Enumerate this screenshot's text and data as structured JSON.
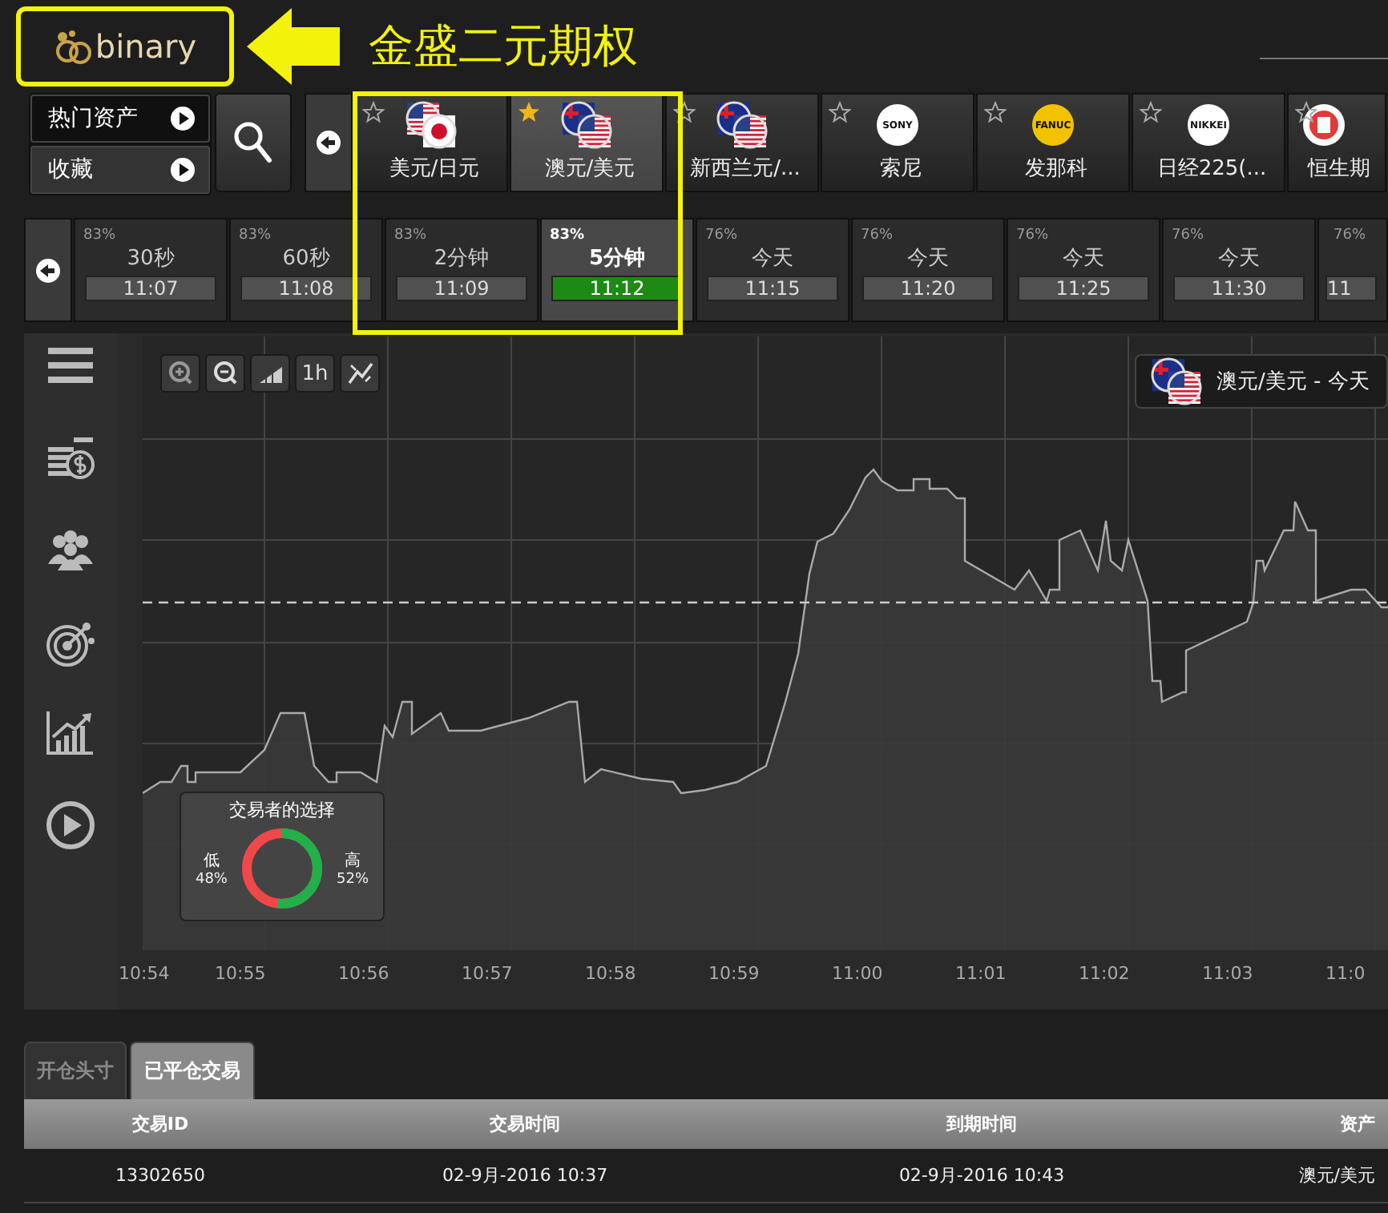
{
  "annotation": {
    "title": "金盛二元期权"
  },
  "logo": {
    "text": "binary"
  },
  "asset_menu": [
    {
      "label": "热门资产",
      "selected": true
    },
    {
      "label": "收藏",
      "selected": false
    }
  ],
  "assets": [
    {
      "label": "美元/日元",
      "starred": false,
      "selected": false,
      "kind": "pair",
      "flags": [
        {
          "kind": "us"
        },
        {
          "kind": "jp"
        }
      ]
    },
    {
      "label": "澳元/美元",
      "starred": true,
      "selected": true,
      "kind": "pair",
      "flags": [
        {
          "kind": "au"
        },
        {
          "kind": "us"
        }
      ]
    },
    {
      "label": "新西兰元/...",
      "starred": false,
      "selected": false,
      "kind": "pair",
      "flags": [
        {
          "kind": "nz"
        },
        {
          "kind": "us"
        }
      ]
    },
    {
      "label": "索尼",
      "starred": false,
      "selected": false,
      "kind": "logo",
      "logo_text": "SONY",
      "color": "#ffffff"
    },
    {
      "label": "发那科",
      "starred": false,
      "selected": false,
      "kind": "logo",
      "logo_text": "FANUC",
      "color": "#f2c200"
    },
    {
      "label": "日经225(...",
      "starred": false,
      "selected": false,
      "kind": "logo",
      "logo_text": "NIKKEI",
      "color": "#ffffff"
    },
    {
      "label": "恒生期",
      "starred": false,
      "selected": false,
      "kind": "emblem",
      "color": "#e03a3a"
    }
  ],
  "expiries": [
    {
      "payout": "83%",
      "label": "30秒",
      "time": "11:07",
      "selected": false
    },
    {
      "payout": "83%",
      "label": "60秒",
      "time": "11:08",
      "selected": false
    },
    {
      "payout": "83%",
      "label": "2分钟",
      "time": "11:09",
      "selected": false
    },
    {
      "payout": "83%",
      "label": "5分钟",
      "time": "11:12",
      "selected": true
    },
    {
      "payout": "76%",
      "label": "今天",
      "time": "11:15",
      "selected": false
    },
    {
      "payout": "76%",
      "label": "今天",
      "time": "11:20",
      "selected": false
    },
    {
      "payout": "76%",
      "label": "今天",
      "time": "11:25",
      "selected": false
    },
    {
      "payout": "76%",
      "label": "今天",
      "time": "11:30",
      "selected": false
    },
    {
      "payout": "76%",
      "time": "11",
      "selected": false
    }
  ],
  "chart": {
    "toolbar": [
      {
        "kind": "zoom-in"
      },
      {
        "kind": "zoom-out"
      },
      {
        "kind": "bars"
      },
      {
        "kind": "text",
        "label": "1h"
      },
      {
        "kind": "line"
      }
    ],
    "badge": {
      "label": "澳元/美元 - 今天",
      "flags": [
        {
          "kind": "au"
        },
        {
          "kind": "us"
        }
      ]
    },
    "time_axis": [
      "10:54",
      "10:55",
      "10:56",
      "10:57",
      "10:58",
      "10:59",
      "11:00",
      "11:01",
      "11:02",
      "11:03",
      "11:0"
    ],
    "sentiment": {
      "title": "交易者的选择",
      "low_label": "低",
      "low_pct": "48%",
      "high_label": "高",
      "high_pct": "52%",
      "level": 0.52
    }
  },
  "trade_tabs": [
    {
      "label": "开仓头寸",
      "selected": false
    },
    {
      "label": "已平仓交易",
      "selected": true
    }
  ],
  "table": {
    "columns": [
      "交易ID",
      "交易时间",
      "到期时间",
      "资产"
    ],
    "rows": [
      [
        "13302650",
        "02-9月-2016 10:37",
        "02-9月-2016 10:43",
        "澳元/美元"
      ]
    ]
  }
}
